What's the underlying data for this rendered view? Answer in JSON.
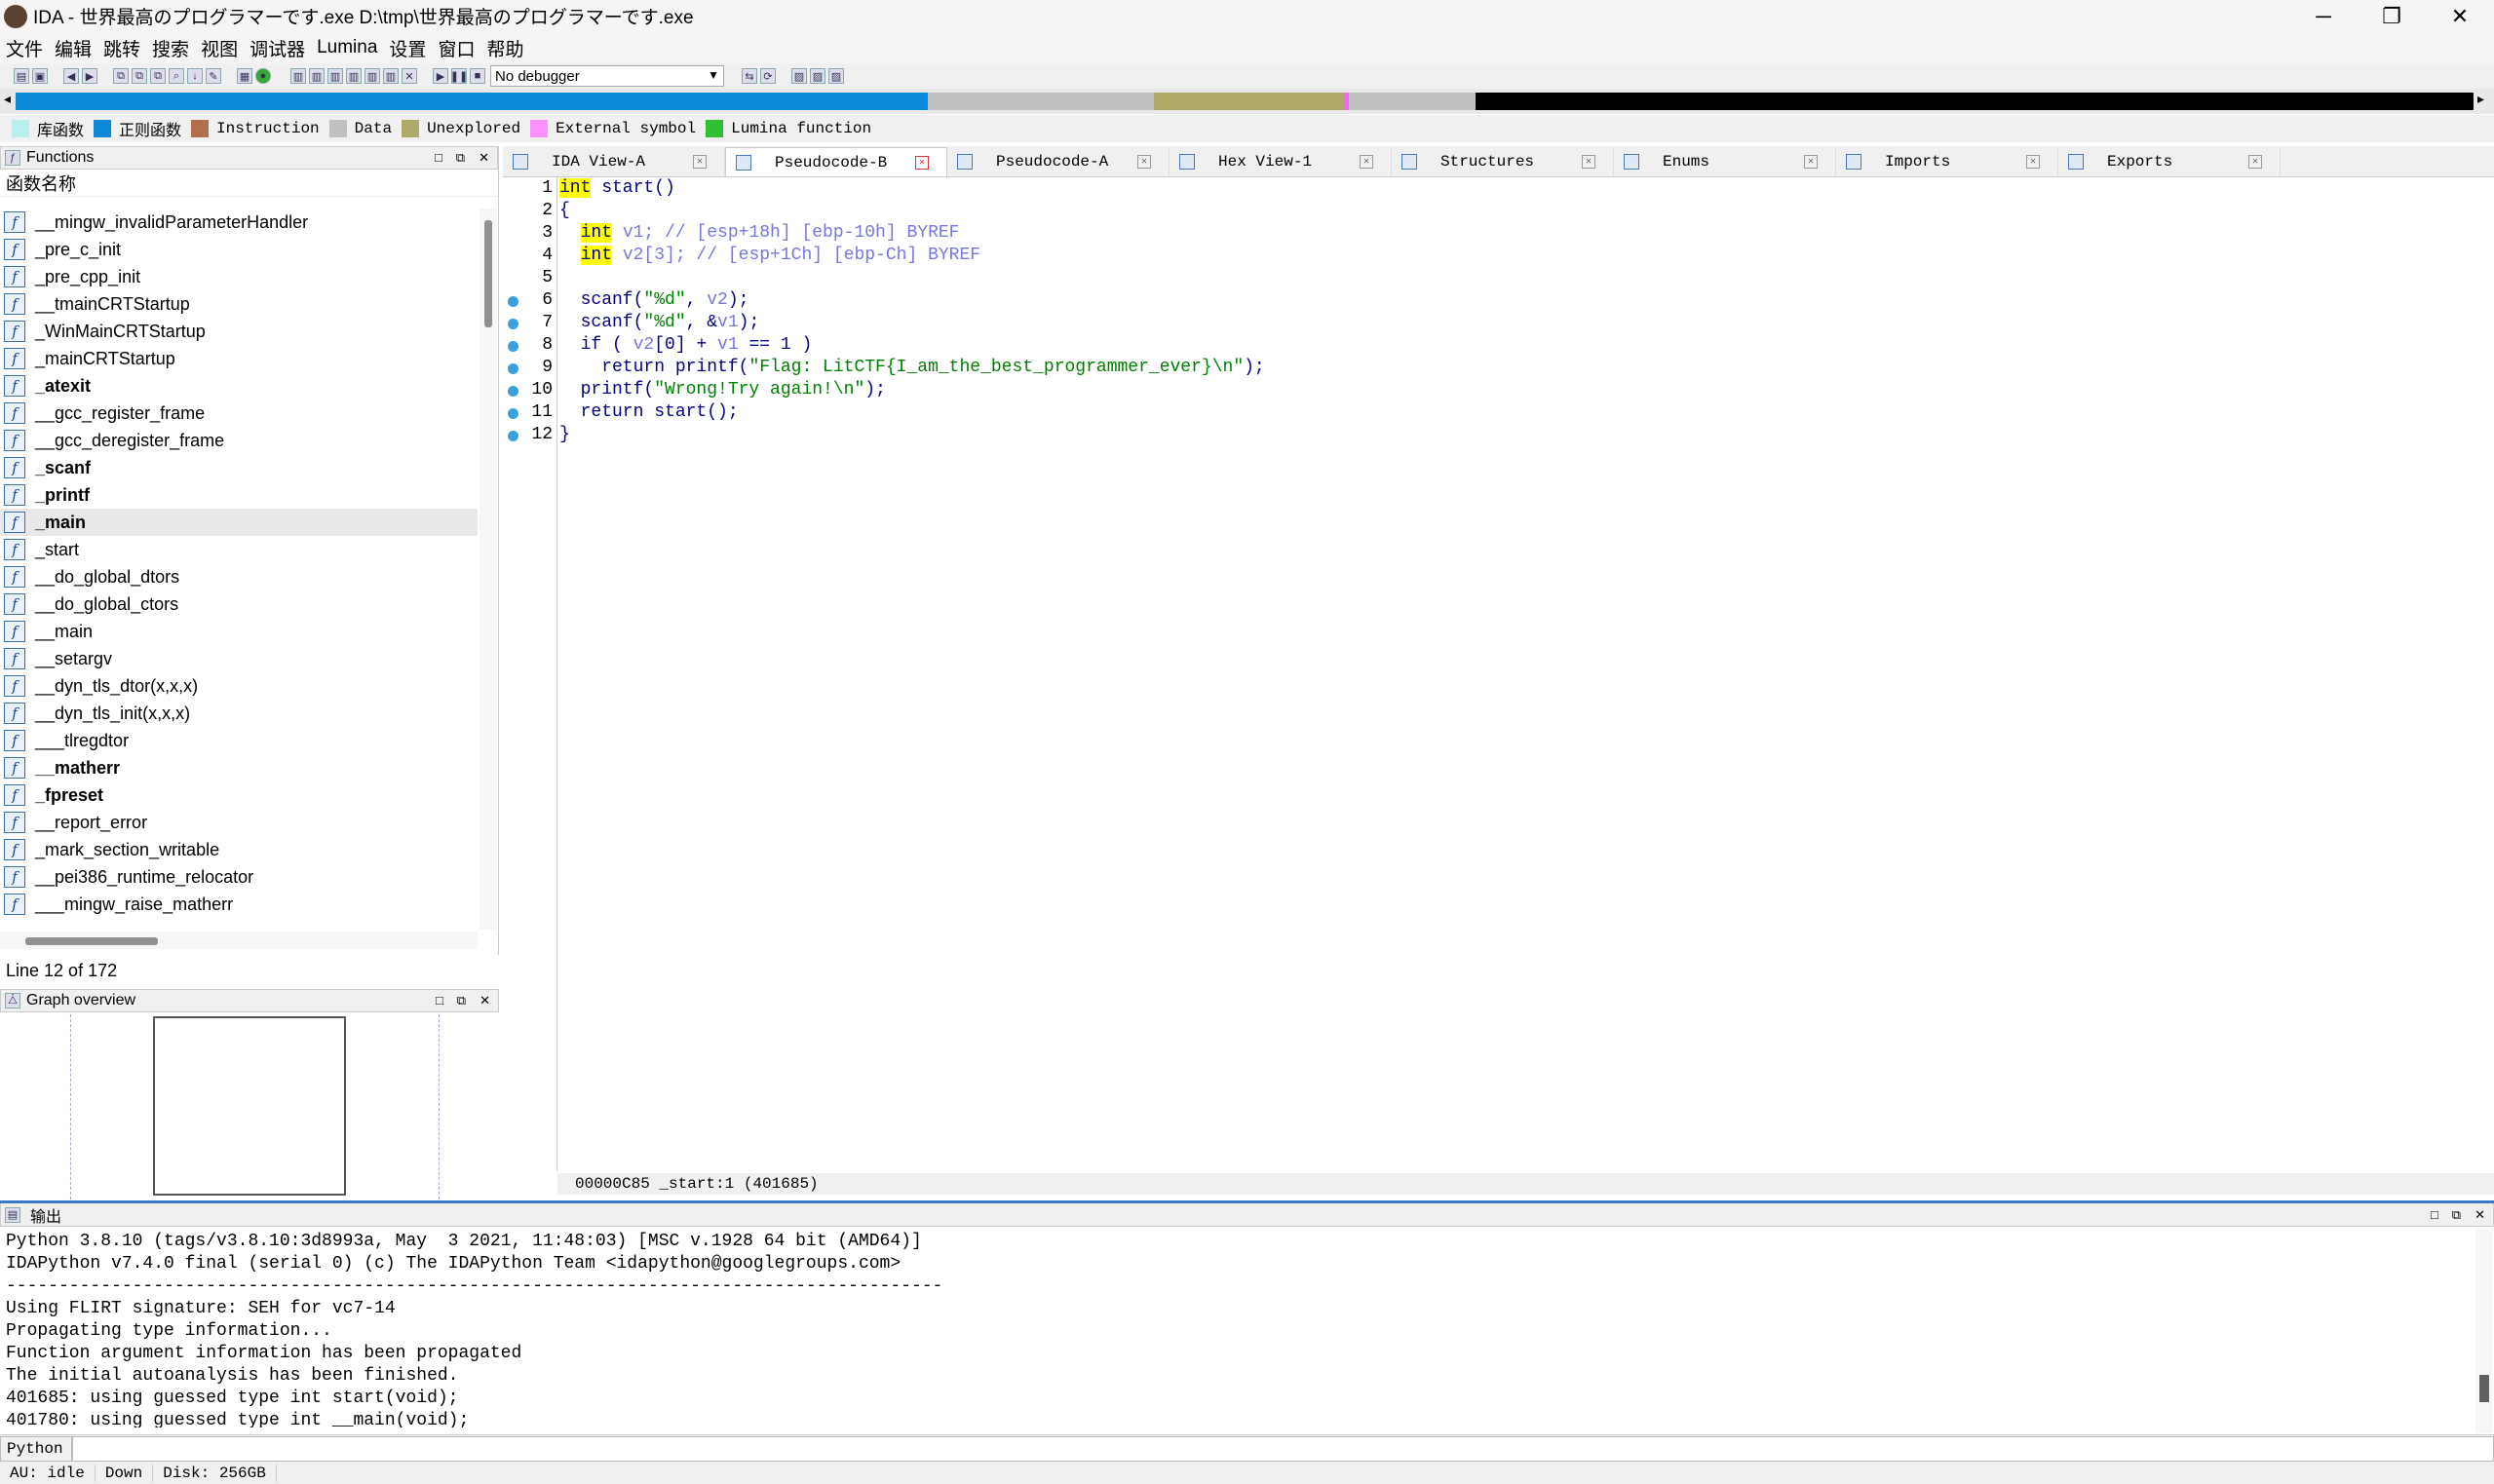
{
  "window": {
    "title": "IDA - 世界最高のプログラマーです.exe D:\\tmp\\世界最高のプログラマーです.exe",
    "minimize": "─",
    "maximize": "❐",
    "close": "✕"
  },
  "menu": [
    "文件",
    "编辑",
    "跳转",
    "搜索",
    "视图",
    "调试器",
    "Lumina",
    "设置",
    "窗口",
    "帮助"
  ],
  "toolbar": {
    "debugger": "No debugger"
  },
  "legend": [
    {
      "label": "库函数",
      "color": "#b8f0f0"
    },
    {
      "label": "正则函数",
      "color": "#0a8ad8"
    },
    {
      "label": "Instruction",
      "color": "#b07050"
    },
    {
      "label": "Data",
      "color": "#c0c0c0"
    },
    {
      "label": "Unexplored",
      "color": "#b0aa6a"
    },
    {
      "label": "External symbol",
      "color": "#ff90ff"
    },
    {
      "label": "Lumina function",
      "color": "#30c030"
    }
  ],
  "functions_pane": {
    "title": "Functions",
    "column": "函数名称",
    "items": [
      {
        "name": "__mingw_invalidParameterHandler",
        "bold": false
      },
      {
        "name": "_pre_c_init",
        "bold": false
      },
      {
        "name": "_pre_cpp_init",
        "bold": false
      },
      {
        "name": "__tmainCRTStartup",
        "bold": false
      },
      {
        "name": "_WinMainCRTStartup",
        "bold": false
      },
      {
        "name": "_mainCRTStartup",
        "bold": false
      },
      {
        "name": "_atexit",
        "bold": true
      },
      {
        "name": "__gcc_register_frame",
        "bold": false
      },
      {
        "name": "__gcc_deregister_frame",
        "bold": false
      },
      {
        "name": "_scanf",
        "bold": true
      },
      {
        "name": "_printf",
        "bold": true
      },
      {
        "name": "_main",
        "bold": true
      },
      {
        "name": "_start",
        "bold": false
      },
      {
        "name": "__do_global_dtors",
        "bold": false
      },
      {
        "name": "__do_global_ctors",
        "bold": false
      },
      {
        "name": "__main",
        "bold": false
      },
      {
        "name": "__setargv",
        "bold": false
      },
      {
        "name": "__dyn_tls_dtor(x,x,x)",
        "bold": false
      },
      {
        "name": "__dyn_tls_init(x,x,x)",
        "bold": false
      },
      {
        "name": "___tlregdtor",
        "bold": false
      },
      {
        "name": "__matherr",
        "bold": true
      },
      {
        "name": "_fpreset",
        "bold": true
      },
      {
        "name": "__report_error",
        "bold": false
      },
      {
        "name": "_mark_section_writable",
        "bold": false
      },
      {
        "name": "__pei386_runtime_relocator",
        "bold": false
      },
      {
        "name": "___mingw_raise_matherr",
        "bold": false
      }
    ],
    "selected_index": 11,
    "status": "Line 12 of 172"
  },
  "graph_pane": {
    "title": "Graph overview"
  },
  "tabs": [
    {
      "label": "IDA View-A",
      "active": false
    },
    {
      "label": "Pseudocode-B",
      "active": true
    },
    {
      "label": "Pseudocode-A",
      "active": false
    },
    {
      "label": "Hex View-1",
      "active": false
    },
    {
      "label": "Structures",
      "active": false
    },
    {
      "label": "Enums",
      "active": false
    },
    {
      "label": "Imports",
      "active": false
    },
    {
      "label": "Exports",
      "active": false
    }
  ],
  "code": {
    "line_numbers": [
      "1",
      "2",
      "3",
      "4",
      "5",
      "6",
      "7",
      "8",
      "9",
      "10",
      "11",
      "12"
    ],
    "breakpoint_lines": [
      6,
      7,
      8,
      9,
      10,
      11,
      12
    ],
    "l1_kw": "int",
    "l1_rest": " start()",
    "l2": "{",
    "l3_kw": "int",
    "l3_var": " v1",
    "l3_cm": "; // [esp+18h] [ebp-10h] BYREF",
    "l4_kw": "int",
    "l4_var": " v2",
    "l4_cm": "[3]; // [esp+1Ch] [ebp-Ch] BYREF",
    "l6_a": "  scanf(",
    "l6_s": "\"%d\"",
    "l6_b": ", ",
    "l6_v": "v2",
    "l6_c": ");",
    "l7_a": "  scanf(",
    "l7_s": "\"%d\"",
    "l7_b": ", &",
    "l7_v": "v1",
    "l7_c": ");",
    "l8_a": "  if ( ",
    "l8_v1": "v2",
    "l8_b": "[0] + ",
    "l8_v2": "v1",
    "l8_c": " == 1 )",
    "l9_a": "    return printf(",
    "l9_s": "\"Flag: LitCTF{I_am_the_best_programmer_ever}\\n\"",
    "l9_c": ");",
    "l10_a": "  printf(",
    "l10_s": "\"Wrong!Try again!\\n\"",
    "l10_c": ");",
    "l11": "  return start();",
    "l12": "}",
    "status": "00000C85 _start:1 (401685)"
  },
  "output": {
    "title": "输出",
    "lines": [
      "Python 3.8.10 (tags/v3.8.10:3d8993a, May  3 2021, 11:48:03) [MSC v.1928 64 bit (AMD64)]",
      "IDAPython v7.4.0 final (serial 0) (c) The IDAPython Team <idapython@googlegroups.com>",
      "-----------------------------------------------------------------------------------------",
      "Using FLIRT signature: SEH for vc7-14",
      "Propagating type information...",
      "Function argument information has been propagated",
      "The initial autoanalysis has been finished.",
      "401685: using guessed type int start(void);",
      "401780: using guessed type int __main(void);"
    ],
    "python_label": "Python"
  },
  "statusbar": {
    "au": "AU:  idle",
    "dir": "Down",
    "disk": "Disk: 256GB"
  }
}
